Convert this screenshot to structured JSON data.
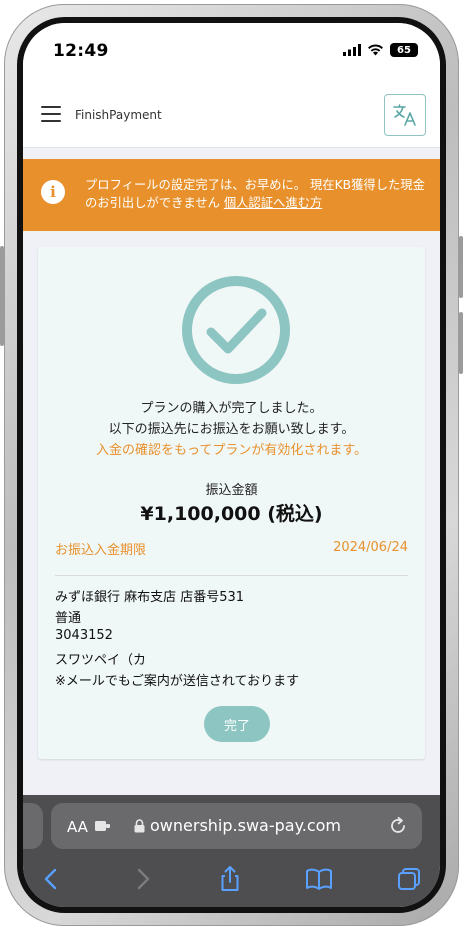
{
  "status_bar": {
    "time": "12:49",
    "battery": "65"
  },
  "app_bar": {
    "title": "FinishPayment"
  },
  "notice": {
    "text": "プロフィールの設定完了は、お早めに。 現在KB獲得した現金のお引出しができません",
    "link": "個人認証へ進む方"
  },
  "card": {
    "message_line1": "プランの購入が完了しました。",
    "message_line2": "以下の振込先にお振込をお願い致します。",
    "message_line3": "入金の確認をもってプランが有効化されます。",
    "amount_label": "振込金額",
    "amount": "¥1,100,000 (税込)",
    "deadline_label": "お振込入金期限",
    "deadline_date": "2024/06/24",
    "bank_lines": [
      "みずほ銀行 麻布支店 店番号531",
      "普通",
      "3043152",
      "スワツペイ（カ",
      "※メールでもご案内が送信されております"
    ],
    "done_button": "完了"
  },
  "browser": {
    "text_size_label": "AA",
    "url": "ownership.swa-pay.com"
  },
  "colors": {
    "accent_orange": "#e8912c",
    "teal": "#8cc5c1",
    "card_bg": "#f0f7f7"
  },
  "icons": [
    "menu-icon",
    "translate-icon",
    "info-icon",
    "check-circle-icon",
    "lock-icon",
    "reload-icon",
    "back-icon",
    "forward-icon",
    "share-icon",
    "bookmarks-icon",
    "tabs-icon"
  ]
}
